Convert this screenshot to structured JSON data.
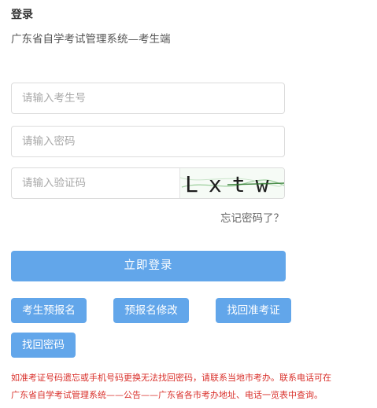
{
  "page": {
    "title": "登录",
    "subtitle": "广东省自学考试管理系统—考生端"
  },
  "form": {
    "exam_no_placeholder": "请输入考生号",
    "password_placeholder": "请输入密码",
    "captcha_placeholder": "请输入验证码",
    "captcha_text": "Lxtw"
  },
  "links": {
    "forgot_password": "忘记密码了？"
  },
  "buttons": {
    "login": "立即登录",
    "pre_register": "考生预报名",
    "edit_pre_register": "预报名修改",
    "retrieve_admission": "找回准考证",
    "retrieve_password": "找回密码"
  },
  "notice": {
    "line1": "如准考证号码遗忘或手机号码更换无法找回密码，请联系当地市考办。联系电话可在",
    "line2": "广东省自学考试管理系统——公告——广东省各市考办地址、电话一览表中查询。"
  },
  "colors": {
    "primary_button": "#62a6ea",
    "notice_text": "#d9302b"
  }
}
